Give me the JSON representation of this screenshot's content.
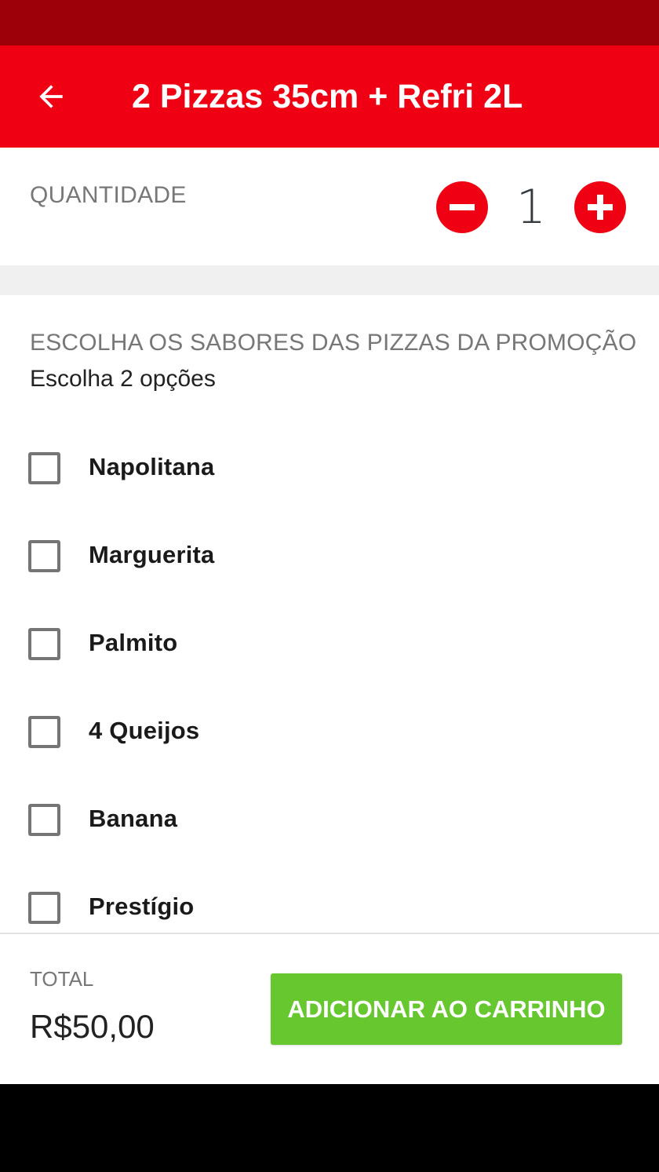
{
  "colors": {
    "status_bar": "#9e0008",
    "app_bar": "#ef0013",
    "accent_red": "#ef0013",
    "add_button": "#66c72f"
  },
  "header": {
    "back_icon": "arrow-left-icon",
    "title": "2 Pizzas 35cm + Refri 2L"
  },
  "quantity": {
    "label": "QUANTIDADE",
    "value": "1",
    "minus_icon": "minus-icon",
    "plus_icon": "plus-icon"
  },
  "flavors": {
    "title": "ESCOLHA OS SABORES DAS PIZZAS DA PROMOÇÃO",
    "subtitle": "Escolha 2 opções",
    "options": [
      {
        "label": "Napolitana",
        "checked": false
      },
      {
        "label": "Marguerita",
        "checked": false
      },
      {
        "label": "Palmito",
        "checked": false
      },
      {
        "label": "4 Queijos",
        "checked": false
      },
      {
        "label": "Banana",
        "checked": false
      },
      {
        "label": "Prestígio",
        "checked": false
      }
    ]
  },
  "footer": {
    "total_label": "TOTAL",
    "total_value": "R$50,00",
    "add_button_label": "ADICIONAR AO CARRINHO"
  }
}
